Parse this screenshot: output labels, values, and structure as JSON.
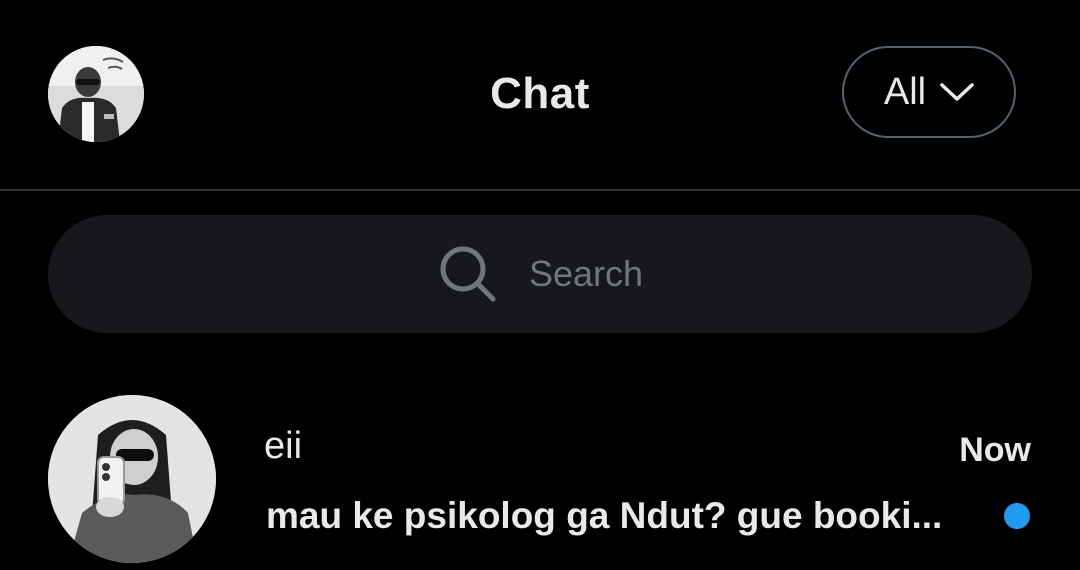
{
  "header": {
    "title": "Chat",
    "filter_label": "All",
    "filter_icon": "chevron-down-icon",
    "avatar_icon": "user-avatar"
  },
  "search": {
    "placeholder": "Search",
    "icon": "search-icon"
  },
  "chats": [
    {
      "name": "eii",
      "time": "Now",
      "preview": "mau ke psikolog ga Ndut? gue booki...",
      "unread": true
    }
  ],
  "colors": {
    "background": "#000000",
    "text_primary": "#e7e9ea",
    "text_secondary": "#71767b",
    "search_bg": "#16181c",
    "divider": "#2f3336",
    "unread_dot": "#1d9bf0"
  }
}
